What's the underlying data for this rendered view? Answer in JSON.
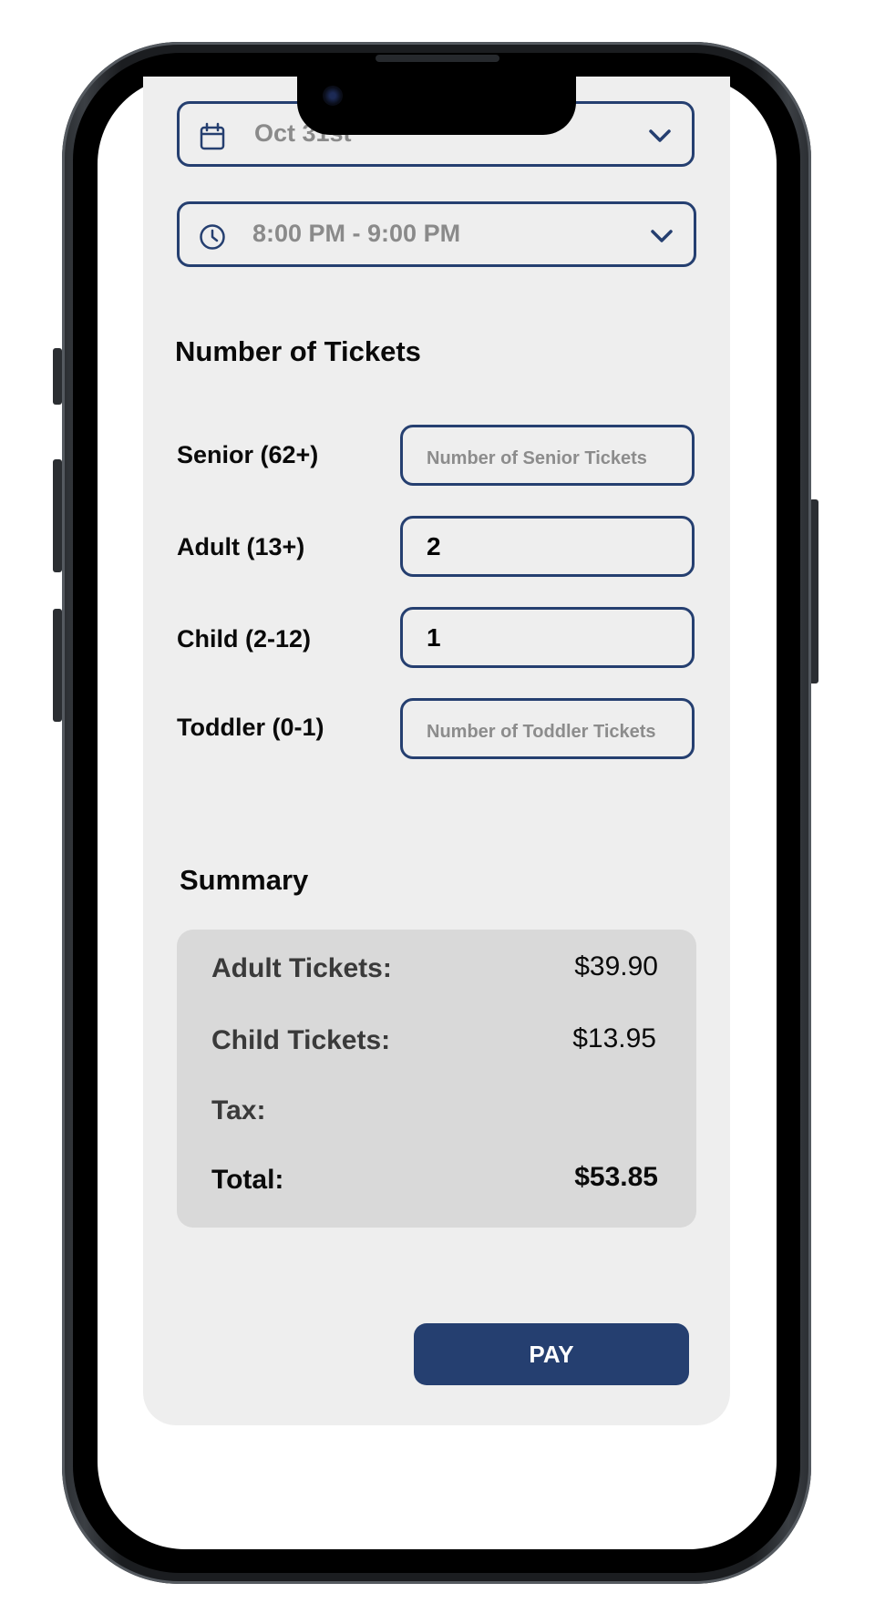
{
  "date_picker": {
    "value": "Oct 31st",
    "icon": "calendar-icon"
  },
  "time_picker": {
    "value": "8:00 PM - 9:00 PM",
    "icon": "clock-icon"
  },
  "tickets": {
    "title": "Number of Tickets",
    "rows": [
      {
        "label": "Senior (62+)",
        "value": "",
        "placeholder": "Number of Senior Tickets"
      },
      {
        "label": "Adult (13+)",
        "value": "2",
        "placeholder": ""
      },
      {
        "label": "Child (2-12)",
        "value": "1",
        "placeholder": ""
      },
      {
        "label": "Toddler (0-1)",
        "value": "",
        "placeholder": "Number of Toddler Tickets"
      }
    ]
  },
  "summary": {
    "title": "Summary",
    "adult_label": "Adult Tickets:",
    "adult_value": "$39.90",
    "child_label": "Child Tickets:",
    "child_value": "$13.95",
    "tax_label": "Tax:",
    "tax_value": "",
    "total_label": "Total:",
    "total_value": "$53.85"
  },
  "pay_button": {
    "label": "PAY"
  },
  "colors": {
    "accent": "#253f70",
    "card_bg": "#eeeeee",
    "summary_bg": "#d9d9d9",
    "placeholder_text": "#8a8a8a"
  }
}
